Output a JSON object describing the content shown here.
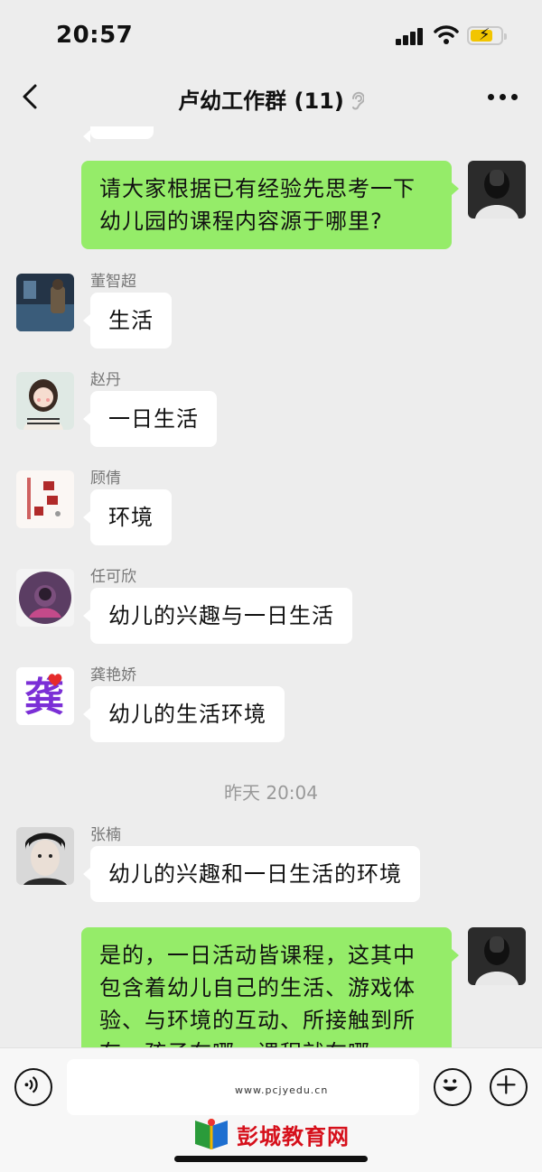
{
  "status_bar": {
    "time": "20:57",
    "icons": [
      "signal-icon",
      "wifi-icon",
      "battery-charging-icon"
    ]
  },
  "header": {
    "title": "卢幼工作群 (11)",
    "icons": [
      "back-chevron-icon",
      "ear-icon",
      "more-icon"
    ]
  },
  "messages": [
    {
      "direction": "out",
      "text": "请大家根据已有经验先思考一下幼儿园的课程内容源于哪里?"
    },
    {
      "direction": "in",
      "sender": "董智超",
      "text": "生活"
    },
    {
      "direction": "in",
      "sender": "赵丹",
      "text": "一日生活"
    },
    {
      "direction": "in",
      "sender": "顾倩",
      "text": "环境"
    },
    {
      "direction": "in",
      "sender": "任可欣",
      "text": "幼儿的兴趣与一日生活"
    },
    {
      "direction": "in",
      "sender": "龚艳娇",
      "text": "幼儿的生活环境"
    },
    {
      "timestamp": "昨天 20:04"
    },
    {
      "direction": "in",
      "sender": "张楠",
      "text": "幼儿的兴趣和一日生活的环境"
    },
    {
      "direction": "out",
      "text": "是的，一日活动皆课程，这其中包含着幼儿自己的生活、游戏体验、与环境的互动、所接触到所有。孩子在哪，课程就在哪。"
    }
  ],
  "avatars": {
    "gong_char": "龚"
  },
  "input_bar": {
    "icons": [
      "voice-icon",
      "emoji-icon",
      "plus-icon"
    ]
  },
  "watermark": {
    "text": "彭城教育网",
    "url": "www.pcjyedu.cn"
  },
  "colors": {
    "background": "#ededed",
    "outgoing_bubble": "#95ec69",
    "incoming_bubble": "#ffffff"
  }
}
